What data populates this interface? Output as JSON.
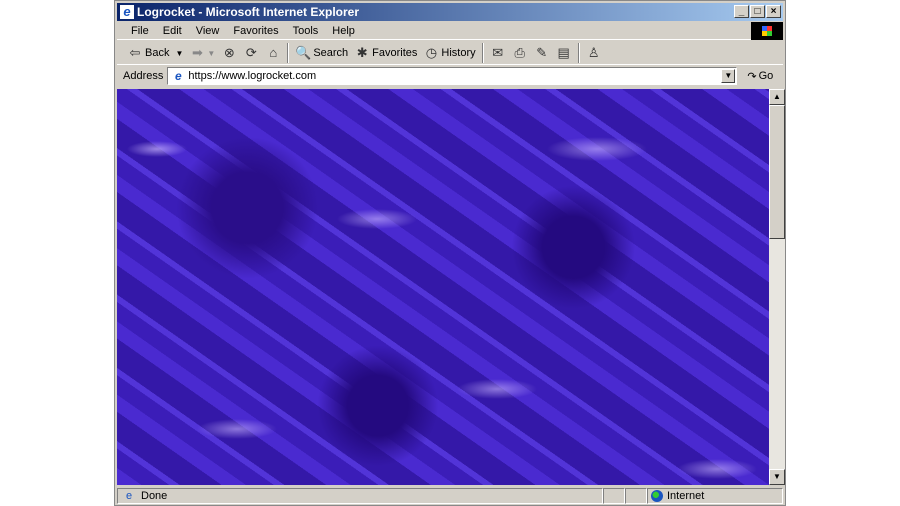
{
  "window": {
    "title": "Logrocket - Microsoft Internet Explorer",
    "controls": [
      "_",
      "□",
      "×"
    ]
  },
  "menu": [
    "File",
    "Edit",
    "View",
    "Favorites",
    "Tools",
    "Help"
  ],
  "toolbar": {
    "back": "Back",
    "search": "Search",
    "favorites": "Favorites",
    "history": "History"
  },
  "address": {
    "label": "Address",
    "url": "https://www.logrocket.com",
    "go": "Go"
  },
  "status": {
    "text": "Done",
    "zone": "Internet"
  }
}
